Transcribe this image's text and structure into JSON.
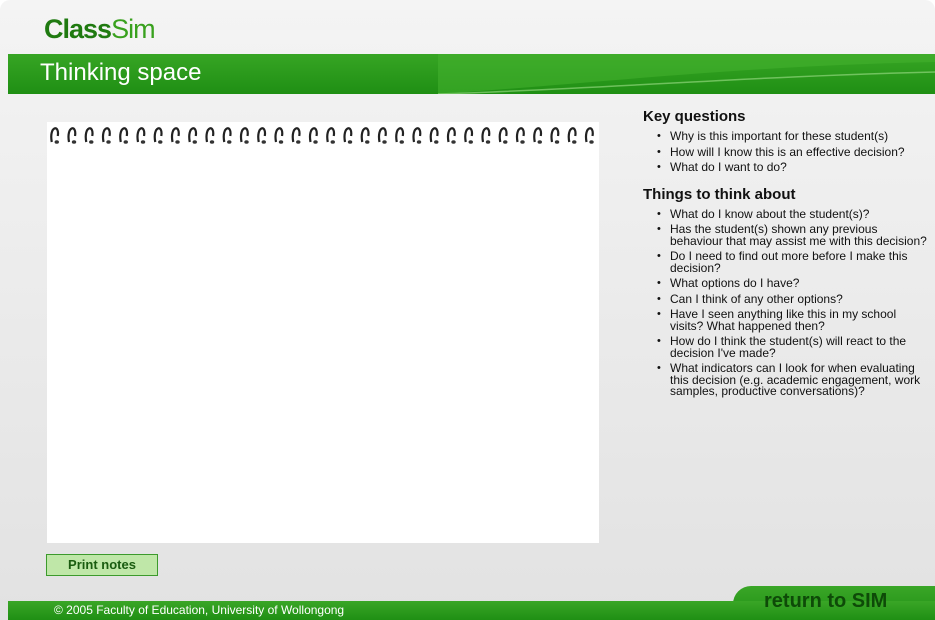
{
  "header": {
    "logo_bold": "Class",
    "logo_thin": "Sim",
    "page_title": "Thinking space"
  },
  "notebook": {
    "notes_value": "",
    "ring_count": 32
  },
  "key_questions": {
    "heading": "Key questions",
    "items": [
      "Why is this important for these student(s)",
      "How will I know this is an effective decision?",
      "What do I want to do?"
    ]
  },
  "things_to_think_about": {
    "heading": "Things to think about",
    "items": [
      "What do I know about the student(s)?",
      "Has the student(s) shown any previous behaviour that may assist me with this decision?",
      "Do I need to find out more before I make this decision?",
      "What options do I have?",
      "Can I think of any other options?",
      "Have I seen anything like this in my school visits? What happened then?",
      "How do I think the student(s) will react to the decision I've made?",
      "What indicators can I look for when evaluating this decision (e.g. academic engagement, work samples, productive conversations)?"
    ]
  },
  "buttons": {
    "print_label": "Print notes",
    "return_label": "return to SIM"
  },
  "footer": {
    "copyright": "© 2005 Faculty of Education, University of Wollongong"
  },
  "colors": {
    "brand_green": "#1f8f14",
    "light_green": "#bfe7a8",
    "dark_green": "#0e4a08"
  }
}
